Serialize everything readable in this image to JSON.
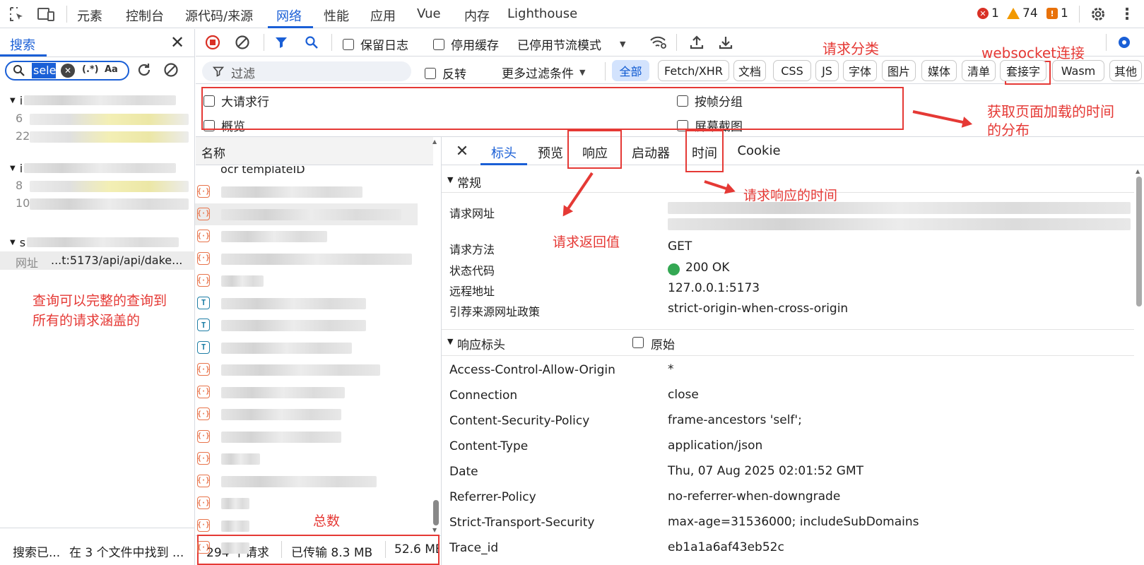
{
  "topbar": {
    "tabs": [
      "元素",
      "控制台",
      "源代码/来源",
      "网络",
      "性能",
      "应用",
      "Vue",
      "内存",
      "Lighthouse"
    ],
    "active_tab": "网络",
    "errors": "1",
    "warnings": "74",
    "issues": "1"
  },
  "search_panel": {
    "tab": "搜索",
    "query": "sele",
    "regex_label": "(.*)",
    "case_label": "Aa",
    "url_label": "网址",
    "url_value": "...t:5173/api/api/dake...",
    "status": "搜索已...",
    "status_detail": "在 3 个文件中找到 ...",
    "result_nums": [
      "6",
      "22",
      "8",
      "10"
    ],
    "group_labels": [
      "i",
      "i",
      "s"
    ]
  },
  "toolbar": {
    "preserve_log": "保留日志",
    "disable_cache": "停用缓存",
    "throttle": "已停用节流模式"
  },
  "filterbar": {
    "placeholder": "过滤",
    "invert": "反转",
    "more_filters": "更多过滤条件",
    "types": [
      "全部",
      "Fetch/XHR",
      "文档",
      "CSS",
      "JS",
      "字体",
      "图片",
      "媒体",
      "清单",
      "套接字",
      "Wasm",
      "其他"
    ],
    "active_type": "全部"
  },
  "options": {
    "large_rows": "大请求行",
    "group_by_frame": "按帧分组",
    "overview": "概览",
    "screenshots": "屏幕截图"
  },
  "request_list": {
    "header": "名称",
    "first_row": "ocr templateID",
    "row_types": [
      "xhr",
      "xhr",
      "xhr",
      "xhr",
      "xhr",
      "doc",
      "doc",
      "doc",
      "xhr",
      "xhr",
      "xhr",
      "xhr",
      "xhr",
      "xhr",
      "xhr",
      "xhr",
      "xhr"
    ]
  },
  "summary": {
    "requests": "294 个请求",
    "transferred": "已传输 8.3 MB",
    "resources": "52.6 MB"
  },
  "detail": {
    "tabs": [
      "标头",
      "预览",
      "响应",
      "启动器",
      "时间",
      "Cookie"
    ],
    "active_tab": "标头",
    "general_title": "常规",
    "general": [
      {
        "k": "请求网址",
        "v": ""
      },
      {
        "k": "请求方法",
        "v": "GET"
      },
      {
        "k": "状态代码",
        "v": "200 OK"
      },
      {
        "k": "远程地址",
        "v": "127.0.0.1:5173"
      },
      {
        "k": "引荐来源网址政策",
        "v": "strict-origin-when-cross-origin"
      }
    ],
    "response_title": "响应标头",
    "raw_label": "原始",
    "response_headers": [
      {
        "k": "Access-Control-Allow-Origin",
        "v": "*"
      },
      {
        "k": "Connection",
        "v": "close"
      },
      {
        "k": "Content-Security-Policy",
        "v": "frame-ancestors 'self';"
      },
      {
        "k": "Content-Type",
        "v": "application/json"
      },
      {
        "k": "Date",
        "v": "Thu, 07 Aug 2025 02:01:52 GMT"
      },
      {
        "k": "Referrer-Policy",
        "v": "no-referrer-when-downgrade"
      },
      {
        "k": "Strict-Transport-Security",
        "v": "max-age=31536000; includeSubDomains"
      },
      {
        "k": "Trace_id",
        "v": "eb1a1a6af43eb52c"
      }
    ]
  },
  "annotations": {
    "category": "请求分类",
    "websocket": "websocket连接",
    "timing_dist": "获取页面加载的时间\n的分布",
    "response_time": "请求响应的时间",
    "return_value": "请求返回值",
    "search_note": "查询可以完整的查询到\n所有的请求涵盖的",
    "total": "总数"
  },
  "colors": {
    "accent": "#1a5fd6",
    "annotation": "#e53935",
    "status_ok": "#34a853",
    "error": "#d93025",
    "warning": "#f29900"
  }
}
